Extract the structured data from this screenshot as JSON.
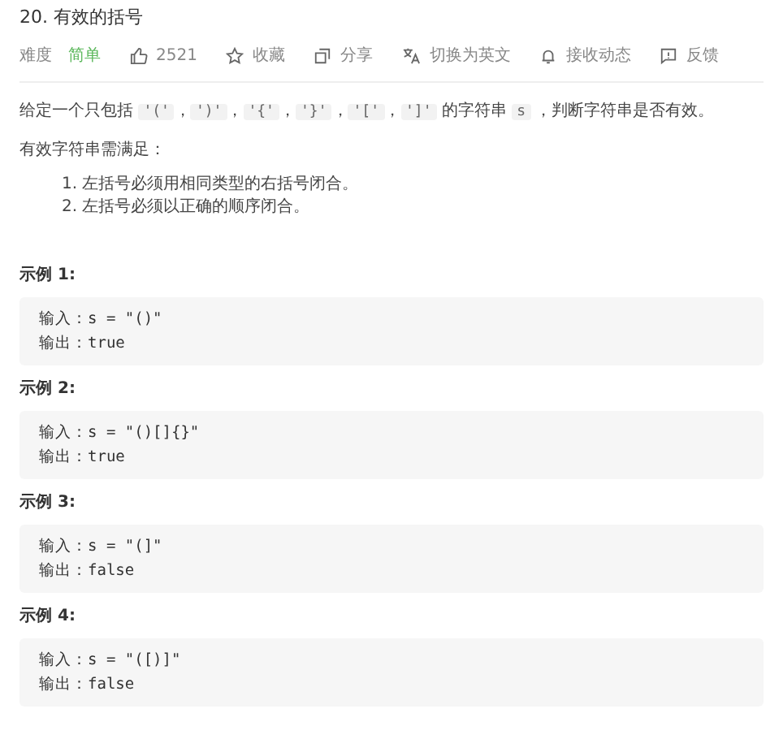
{
  "title": "20. 有效的括号",
  "meta": {
    "difficulty_label": "难度",
    "difficulty": "简单",
    "likes": "2521",
    "actions": [
      {
        "kind": "star",
        "label": "收藏"
      },
      {
        "kind": "share",
        "label": "分享"
      },
      {
        "kind": "translate",
        "label": "切换为英文"
      },
      {
        "kind": "bell",
        "label": "接收动态"
      },
      {
        "kind": "feedback",
        "label": "反馈"
      }
    ]
  },
  "description": [
    {
      "text": "给定一个只包括 ",
      "code": false
    },
    {
      "text": "'('",
      "code": true
    },
    {
      "text": "，",
      "code": false
    },
    {
      "text": "')'",
      "code": true
    },
    {
      "text": "，",
      "code": false
    },
    {
      "text": "'{'",
      "code": true
    },
    {
      "text": "，",
      "code": false
    },
    {
      "text": "'}'",
      "code": true
    },
    {
      "text": "，",
      "code": false
    },
    {
      "text": "'['",
      "code": true
    },
    {
      "text": "，",
      "code": false
    },
    {
      "text": "']'",
      "code": true
    },
    {
      "text": " 的字符串 ",
      "code": false
    },
    {
      "text": "s",
      "code": true
    },
    {
      "text": " ，判断字符串是否有效。",
      "code": false
    }
  ],
  "rules_intro": "有效字符串需满足：",
  "rules": [
    {
      "marker": "1.",
      "text": "左括号必须用相同类型的右括号闭合。"
    },
    {
      "marker": "2.",
      "text": "左括号必须以正确的顺序闭合。"
    }
  ],
  "examples": [
    {
      "heading": "示例 1:",
      "input_label": "输入：",
      "input": "s = \"()\"",
      "output_label": "输出：",
      "output": "true"
    },
    {
      "heading": "示例 2:",
      "input_label": "输入：",
      "input": "s = \"()[]{}\"",
      "output_label": "输出：",
      "output": "true"
    },
    {
      "heading": "示例 3:",
      "input_label": "输入：",
      "input": "s = \"(]\"",
      "output_label": "输出：",
      "output": "false"
    },
    {
      "heading": "示例 4:",
      "input_label": "输入：",
      "input": "s = \"([)]\"",
      "output_label": "输出：",
      "output": "false"
    }
  ]
}
